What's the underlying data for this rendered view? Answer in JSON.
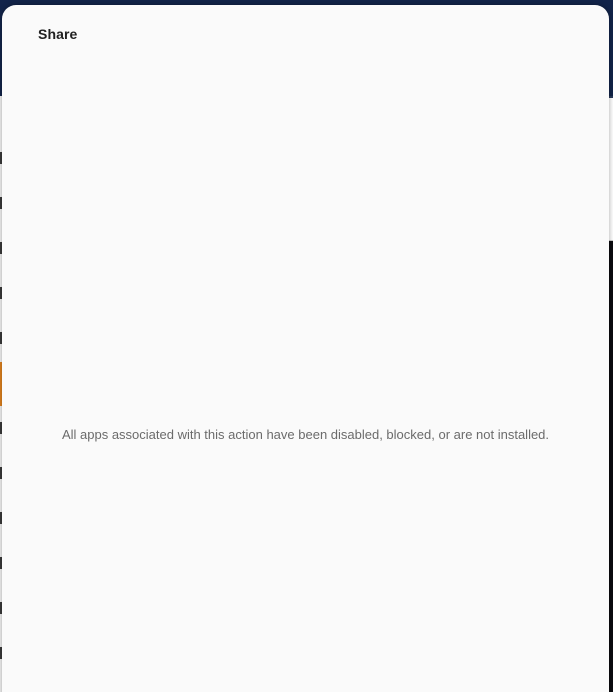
{
  "share_sheet": {
    "title": "Share",
    "empty_message": "All apps associated with this action have been disabled, blocked, or are not installed."
  },
  "colors": {
    "sheet_background": "#fafafa",
    "title_text": "#212121",
    "message_text": "#6b6b6b",
    "background_app_header": "#12244a",
    "background_app_accent": "#e3831e"
  }
}
